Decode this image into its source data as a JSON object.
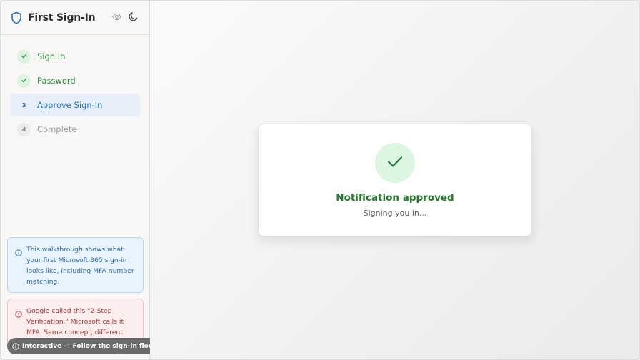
{
  "app": {
    "title": "First Sign-In"
  },
  "header": {
    "icons": [
      "eye-icon",
      "moon-icon"
    ]
  },
  "steps": [
    {
      "badge": "",
      "label": "Sign In",
      "state": "done"
    },
    {
      "badge": "",
      "label": "Password",
      "state": "done"
    },
    {
      "badge": "3",
      "label": "Approve Sign-In",
      "state": "active"
    },
    {
      "badge": "4",
      "label": "Complete",
      "state": "pending"
    }
  ],
  "info": {
    "text": "This walkthrough shows what your first Microsoft 365 sign-in looks like, including MFA number matching."
  },
  "warning": {
    "text": "Google called this \"2-Step Verification.\" Microsoft calls it MFA. Same concept, different"
  },
  "status_pill": {
    "text": "Interactive — Follow the sign-in flow"
  },
  "card": {
    "title": "Notification approved",
    "subtitle": "Signing you in..."
  },
  "colors": {
    "accent": "#1f6fbf",
    "success": "#237a2c",
    "success_bg": "#dcf6e1",
    "info_bg": "#e9f3fd",
    "warning_bg": "#fdeeee"
  }
}
